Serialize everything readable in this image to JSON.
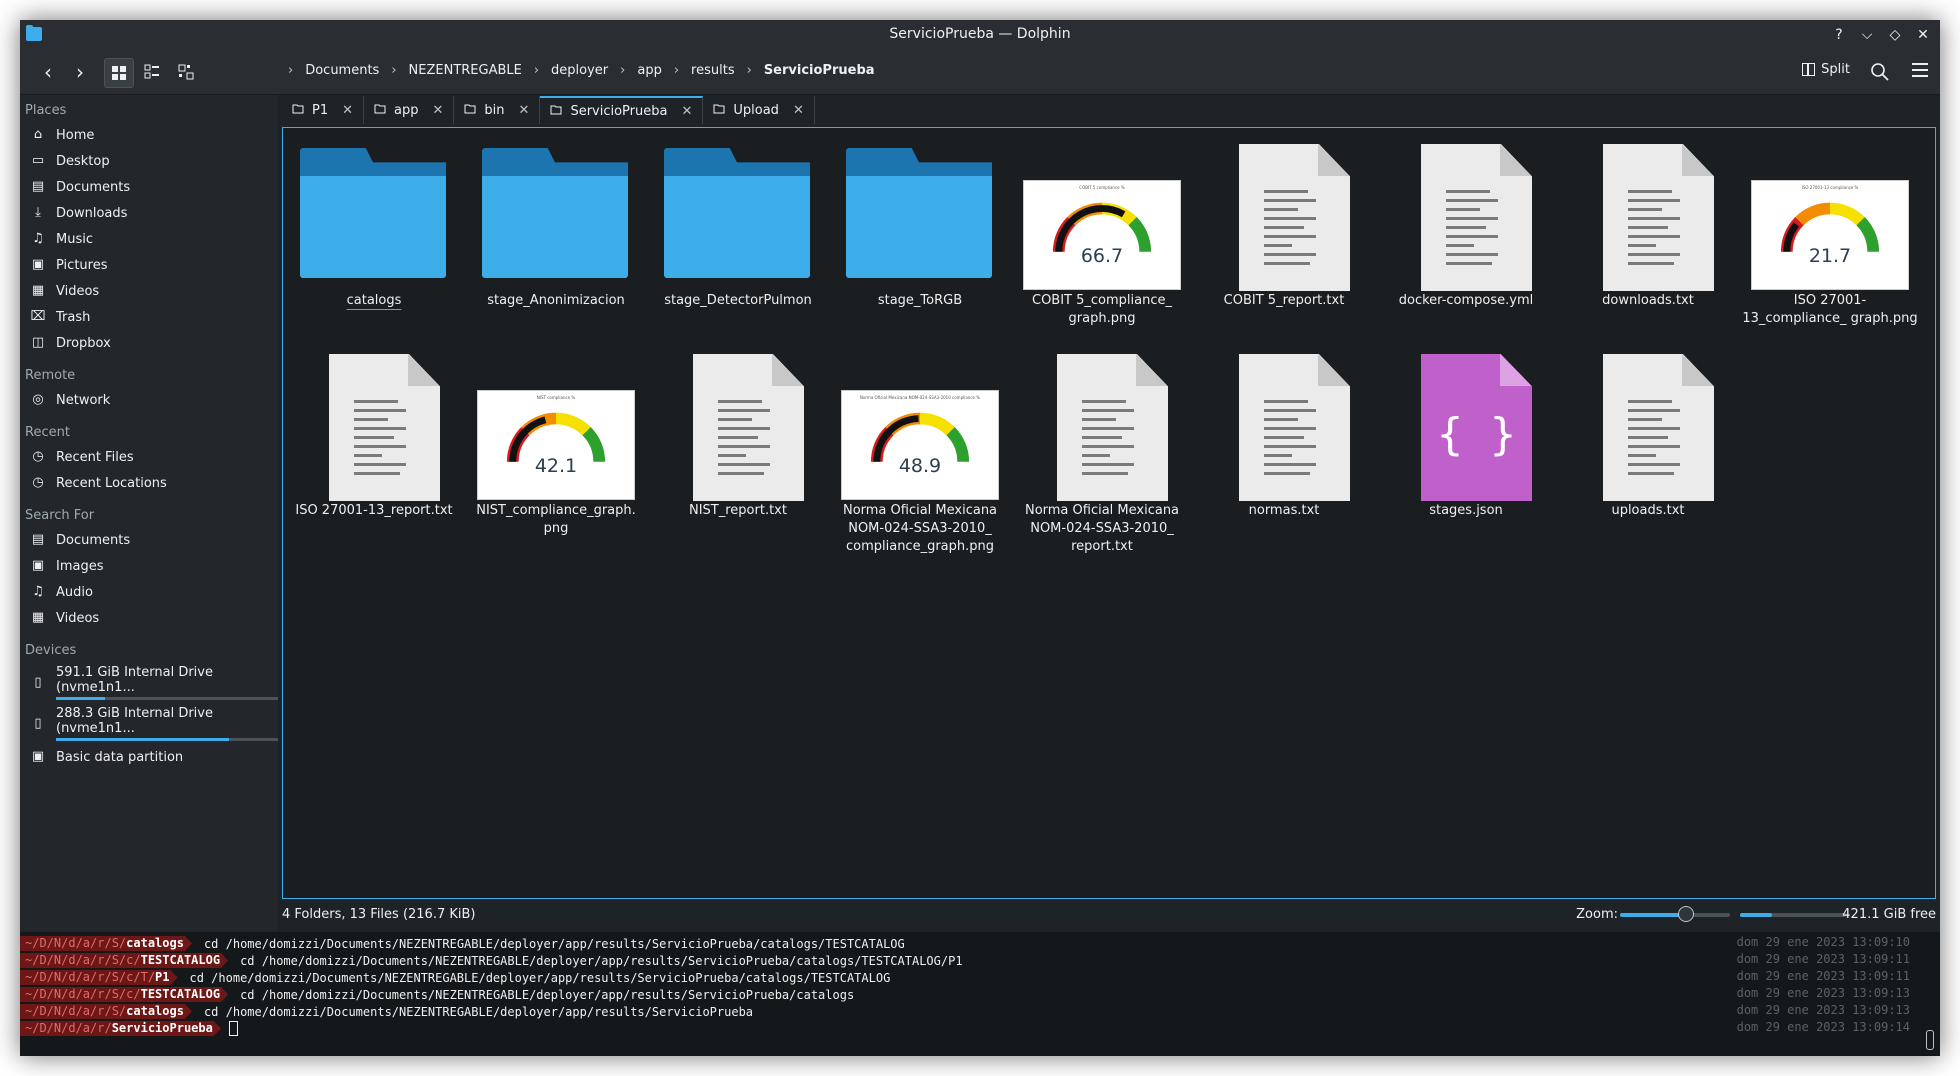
{
  "window": {
    "title": "ServicioPrueba — Dolphin"
  },
  "titlebar_buttons": [
    "?",
    "⌵",
    "◇",
    "✕"
  ],
  "breadcrumb": [
    "Documents",
    "NEZENTREGABLE",
    "deployer",
    "app",
    "results",
    "ServicioPrueba"
  ],
  "toolbar": {
    "split_label": "Split"
  },
  "sidebar": {
    "places_title": "Places",
    "places": [
      {
        "label": "Home",
        "icon": "⌂"
      },
      {
        "label": "Desktop",
        "icon": "▭"
      },
      {
        "label": "Documents",
        "icon": "▤"
      },
      {
        "label": "Downloads",
        "icon": "⤓"
      },
      {
        "label": "Music",
        "icon": "♫"
      },
      {
        "label": "Pictures",
        "icon": "▣"
      },
      {
        "label": "Videos",
        "icon": "▦"
      },
      {
        "label": "Trash",
        "icon": "⌧"
      },
      {
        "label": "Dropbox",
        "icon": "◫"
      }
    ],
    "remote_title": "Remote",
    "remote": [
      {
        "label": "Network",
        "icon": "◎"
      }
    ],
    "recent_title": "Recent",
    "recent": [
      {
        "label": "Recent Files",
        "icon": "◷"
      },
      {
        "label": "Recent Locations",
        "icon": "◷"
      }
    ],
    "search_title": "Search For",
    "search": [
      {
        "label": "Documents",
        "icon": "▤"
      },
      {
        "label": "Images",
        "icon": "▣"
      },
      {
        "label": "Audio",
        "icon": "♫"
      },
      {
        "label": "Videos",
        "icon": "▦"
      }
    ],
    "devices_title": "Devices",
    "devices": [
      {
        "label": "591.1 GiB Internal Drive (nvme1n1...",
        "used_fraction": 0.22
      },
      {
        "label": "288.3 GiB Internal Drive (nvme1n1...",
        "used_fraction": 0.78
      }
    ],
    "partition": "Basic data partition"
  },
  "tabs": [
    {
      "label": "P1",
      "active": false
    },
    {
      "label": "app",
      "active": false
    },
    {
      "label": "bin",
      "active": false
    },
    {
      "label": "ServicioPrueba",
      "active": true
    },
    {
      "label": "Upload",
      "active": false
    }
  ],
  "files": [
    {
      "name": "catalogs",
      "type": "folder"
    },
    {
      "name": "stage_Anonimizacion",
      "type": "folder"
    },
    {
      "name": "stage_DetectorPulmon",
      "type": "folder"
    },
    {
      "name": "stage_ToRGB",
      "type": "folder"
    },
    {
      "name": "COBIT 5_compliance_ graph.png",
      "type": "gauge",
      "value": "66.7",
      "gauge_title": "COBIT 5 compliance %",
      "fraction": 0.667
    },
    {
      "name": "COBIT 5_report.txt",
      "type": "text"
    },
    {
      "name": "docker-compose.yml",
      "type": "text"
    },
    {
      "name": "downloads.txt",
      "type": "text"
    },
    {
      "name": "ISO 27001-13_compliance_ graph.png",
      "type": "gauge",
      "value": "21.7",
      "gauge_title": "ISO 27001-13 compliance %",
      "fraction": 0.217
    },
    {
      "name": "ISO 27001-13_report.txt",
      "type": "text"
    },
    {
      "name": "NIST_compliance_graph. png",
      "type": "gauge",
      "value": "42.1",
      "gauge_title": "NIST compliance %",
      "fraction": 0.421
    },
    {
      "name": "NIST_report.txt",
      "type": "text"
    },
    {
      "name": "Norma Oficial Mexicana NOM-024-SSA3-2010_ compliance_graph.png",
      "type": "gauge",
      "value": "48.9",
      "gauge_title": "Norma Oficial Mexicana NOM-024-SSA3-2010 compliance %",
      "fraction": 0.489
    },
    {
      "name": "Norma Oficial Mexicana NOM-024-SSA3-2010_ report.txt",
      "type": "text"
    },
    {
      "name": "normas.txt",
      "type": "text"
    },
    {
      "name": "stages.json",
      "type": "json"
    },
    {
      "name": "uploads.txt",
      "type": "text"
    }
  ],
  "statusbar": {
    "summary": "4 Folders, 13 Files (216.7 KiB)",
    "zoom_label": "Zoom:",
    "zoom_fraction": 0.6,
    "free_space": "421.1 GiB free",
    "used_fraction": 0.3
  },
  "terminal": [
    {
      "prompt_pre": "~/D/N/d/a/r/S/",
      "prompt_bold": "catalogs",
      "cmd": "cd /home/domizzi/Documents/NEZENTREGABLE/deployer/app/results/ServicioPrueba/catalogs/TESTCATALOG",
      "time": "dom 29 ene 2023 13:09:10"
    },
    {
      "prompt_pre": "~/D/N/d/a/r/S/c/",
      "prompt_bold": "TESTCATALOG",
      "cmd": "cd /home/domizzi/Documents/NEZENTREGABLE/deployer/app/results/ServicioPrueba/catalogs/TESTCATALOG/P1",
      "time": "dom 29 ene 2023 13:09:11"
    },
    {
      "prompt_pre": "~/D/N/d/a/r/S/c/T/",
      "prompt_bold": "P1",
      "cmd": "cd /home/domizzi/Documents/NEZENTREGABLE/deployer/app/results/ServicioPrueba/catalogs/TESTCATALOG",
      "time": "dom 29 ene 2023 13:09:11"
    },
    {
      "prompt_pre": "~/D/N/d/a/r/S/c/",
      "prompt_bold": "TESTCATALOG",
      "cmd": "cd /home/domizzi/Documents/NEZENTREGABLE/deployer/app/results/ServicioPrueba/catalogs",
      "time": "dom 29 ene 2023 13:09:13"
    },
    {
      "prompt_pre": "~/D/N/d/a/r/S/",
      "prompt_bold": "catalogs",
      "cmd": "cd /home/domizzi/Documents/NEZENTREGABLE/deployer/app/results/ServicioPrueba",
      "time": "dom 29 ene 2023 13:09:13"
    },
    {
      "prompt_pre": "~/D/N/d/a/r/",
      "prompt_bold": "ServicioPrueba",
      "cmd": "",
      "time": "dom 29 ene 2023 13:09:14"
    }
  ]
}
